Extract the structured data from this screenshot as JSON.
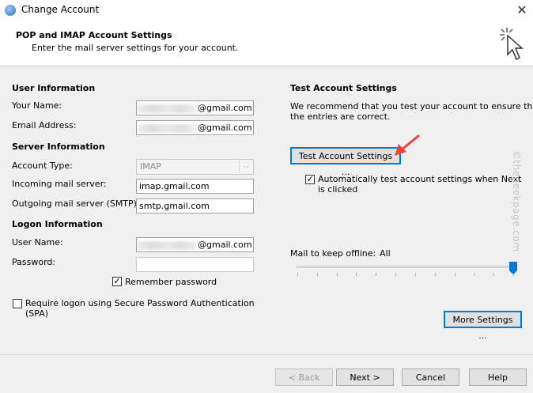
{
  "window": {
    "title": "Change Account",
    "close_glyph": "✕"
  },
  "header": {
    "title": "POP and IMAP Account Settings",
    "subtitle": "Enter the mail server settings for your account."
  },
  "user_information": {
    "heading": "User Information",
    "your_name_label": "Your Name:",
    "your_name_value": "@gmail.com",
    "email_label": "Email Address:",
    "email_value": "@gmail.com"
  },
  "server_information": {
    "heading": "Server Information",
    "account_type_label": "Account Type:",
    "account_type_value": "IMAP",
    "incoming_label": "Incoming mail server:",
    "incoming_value": "imap.gmail.com",
    "outgoing_label": "Outgoing mail server (SMTP):",
    "outgoing_value": "smtp.gmail.com"
  },
  "logon_information": {
    "heading": "Logon Information",
    "username_label": "User Name:",
    "username_value": "@gmail.com",
    "password_label": "Password:",
    "password_value": "",
    "remember_label": "Remember password",
    "remember_checked": true,
    "spa_label_line1": "Require logon using Secure Password Authentication",
    "spa_label_line2": "(SPA)",
    "spa_checked": false
  },
  "test_settings": {
    "heading": "Test Account Settings",
    "description_line1": "We recommend that you test your account to ensure that",
    "description_line2": "the entries are correct.",
    "test_button": "Test Account Settings ...",
    "auto_test_line1": "Automatically test account settings when Next",
    "auto_test_line2": "is clicked",
    "auto_test_checked": true
  },
  "offline": {
    "label": "Mail to keep offline:",
    "value": "All",
    "slider_fraction": 1.0
  },
  "more_settings_button": "More Settings ...",
  "footer": {
    "back": "< Back",
    "next": "Next >",
    "cancel": "Cancel",
    "help": "Help"
  },
  "watermark": "©thegeekpage.com",
  "colors": {
    "accent": "#0078d7",
    "annotation_arrow": "#e8453c"
  },
  "icons": {
    "app": "outlook-globe-icon",
    "header": "click-cursor-icon",
    "annotation": "red-arrow-icon"
  }
}
